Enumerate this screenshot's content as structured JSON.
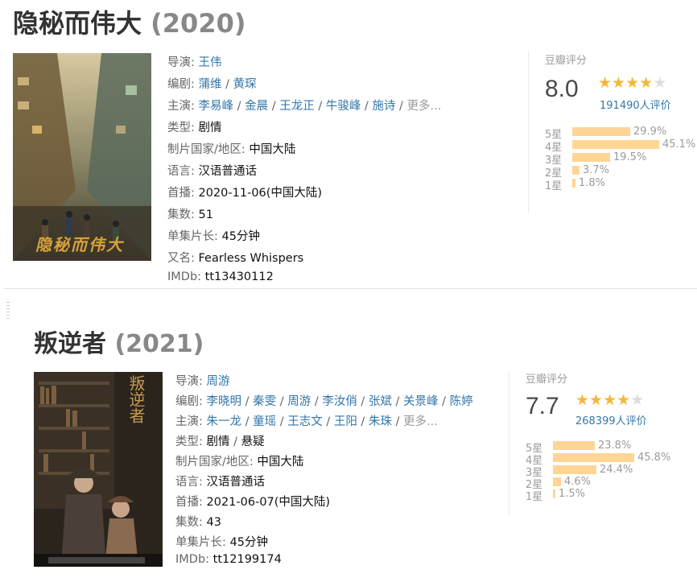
{
  "movies": [
    {
      "title": "隐秘而伟大",
      "year": "(2020)",
      "director_label": "导演:",
      "director": [
        "王伟"
      ],
      "writer_label": "编剧:",
      "writers": [
        "蒲维",
        "黄琛"
      ],
      "cast_label": "主演:",
      "cast": [
        "李易峰",
        "金晨",
        "王龙正",
        "牛骏峰",
        "施诗"
      ],
      "more": "更多...",
      "genre_label": "类型:",
      "genres": [
        "剧情"
      ],
      "country_label": "制片国家/地区:",
      "country": "中国大陆",
      "language_label": "语言:",
      "language": "汉语普通话",
      "premiere_label": "首播:",
      "premiere": "2020-11-06(中国大陆)",
      "episodes_label": "集数:",
      "episodes": "51",
      "runtime_label": "单集片长:",
      "runtime": "45分钟",
      "aka_label": "又名:",
      "aka": "Fearless Whispers",
      "imdb_label": "IMDb:",
      "imdb": "tt13430112",
      "poster_text": "隐秘而伟大",
      "rating": {
        "label": "豆瓣评分",
        "score": "8.0",
        "stars": 4,
        "votes": "191490人评价",
        "dist": [
          {
            "label": "5星",
            "pct": "29.9%",
            "value": 29.9
          },
          {
            "label": "4星",
            "pct": "45.1%",
            "value": 45.1
          },
          {
            "label": "3星",
            "pct": "19.5%",
            "value": 19.5
          },
          {
            "label": "2星",
            "pct": "3.7%",
            "value": 3.7
          },
          {
            "label": "1星",
            "pct": "1.8%",
            "value": 1.8
          }
        ]
      }
    },
    {
      "title": "叛逆者",
      "year": "(2021)",
      "director_label": "导演:",
      "director": [
        "周游"
      ],
      "writer_label": "编剧:",
      "writers": [
        "李晓明",
        "秦雯",
        "周游",
        "李汝俏",
        "张斌",
        "关景峰",
        "陈婷"
      ],
      "cast_label": "主演:",
      "cast": [
        "朱一龙",
        "童瑶",
        "王志文",
        "王阳",
        "朱珠"
      ],
      "more": "更多...",
      "genre_label": "类型:",
      "genres": [
        "剧情",
        "悬疑"
      ],
      "country_label": "制片国家/地区:",
      "country": "中国大陆",
      "language_label": "语言:",
      "language": "汉语普通话",
      "premiere_label": "首播:",
      "premiere": "2021-06-07(中国大陆)",
      "episodes_label": "集数:",
      "episodes": "43",
      "runtime_label": "单集片长:",
      "runtime": "45分钟",
      "imdb_label": "IMDb:",
      "imdb": "tt12199174",
      "poster_text": "叛逆者",
      "rating": {
        "label": "豆瓣评分",
        "score": "7.7",
        "stars": 4,
        "votes": "268399人评价",
        "dist": [
          {
            "label": "5星",
            "pct": "23.8%",
            "value": 23.8
          },
          {
            "label": "4星",
            "pct": "45.8%",
            "value": 45.8
          },
          {
            "label": "3星",
            "pct": "24.4%",
            "value": 24.4
          },
          {
            "label": "2星",
            "pct": "4.6%",
            "value": 4.6
          },
          {
            "label": "1星",
            "pct": "1.5%",
            "value": 1.5
          }
        ]
      }
    }
  ],
  "colors": {
    "link": "#3377aa",
    "star": "#f4b73b",
    "bar": "#ffd596"
  }
}
